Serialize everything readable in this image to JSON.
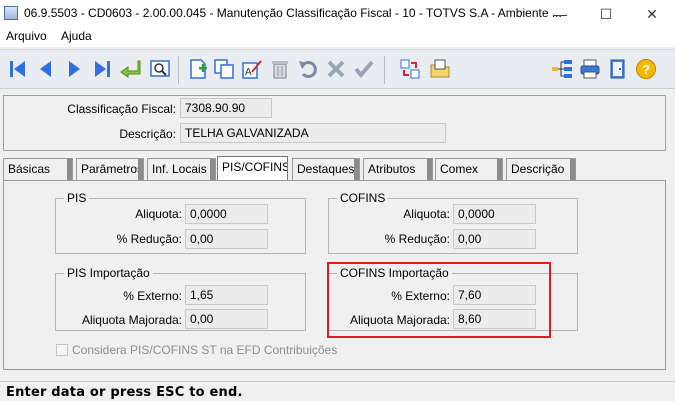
{
  "window": {
    "title": "06.9.5503 - CD0603 - 2.00.00.045 - Manutenção Classificação Fiscal - 10 - TOTVS S.A - Ambiente ...",
    "minimize": "—",
    "maximize": "☐",
    "close": "✕"
  },
  "menu": {
    "arquivo": "Arquivo",
    "ajuda": "Ajuda"
  },
  "header": {
    "classificacao_label": "Classificação Fiscal:",
    "classificacao_value": "7308.90.90",
    "descricao_label": "Descrição:",
    "descricao_value": "TELHA GALVANIZADA"
  },
  "tabs": [
    "Básicas",
    "Parâmetros",
    "Inf. Locais",
    "PIS/COFINS",
    "Destaques",
    "Atributos",
    "Comex",
    "Descrição"
  ],
  "active_tab": "PIS/COFINS",
  "pis": {
    "title": "PIS",
    "aliquota_label": "Aliquota:",
    "aliquota_value": "0,0000",
    "reducao_label": "% Redução:",
    "reducao_value": "0,00"
  },
  "cofins": {
    "title": "COFINS",
    "aliquota_label": "Aliquota:",
    "aliquota_value": "0,0000",
    "reducao_label": "% Redução:",
    "reducao_value": "0,00"
  },
  "pis_importacao": {
    "title": "PIS Importação",
    "externo_label": "% Externo:",
    "externo_value": "1,65",
    "majorada_label": "Aliquota Majorada:",
    "majorada_value": "0,00"
  },
  "cofins_importacao": {
    "title": "COFINS Importação",
    "externo_label": "% Externo:",
    "externo_value": "7,60",
    "majorada_label": "Aliquota Majorada:",
    "majorada_value": "8,60"
  },
  "considera_st": {
    "label": "Considera PIS/COFINS ST na EFD Contribuições",
    "checked": false,
    "enabled": false
  },
  "status": {
    "message": "Enter data or press ESC to end."
  },
  "icons": [
    "first-record-icon",
    "previous-record-icon",
    "next-record-icon",
    "last-record-icon",
    "back-arrow-icon",
    "search-record-icon",
    "new-document-icon",
    "copy-document-icon",
    "edit-text-icon",
    "delete-trash-icon",
    "undo-icon",
    "cancel-x-icon",
    "confirm-check-icon",
    "swap-icon",
    "folder-icon",
    "hierarchy-icon",
    "print-icon",
    "exit-door-icon",
    "help-icon"
  ],
  "colors": {
    "highlight": "#e31b1b",
    "nav_blue": "#2f6fe0",
    "toolbar_bg": "#e9edf2"
  }
}
